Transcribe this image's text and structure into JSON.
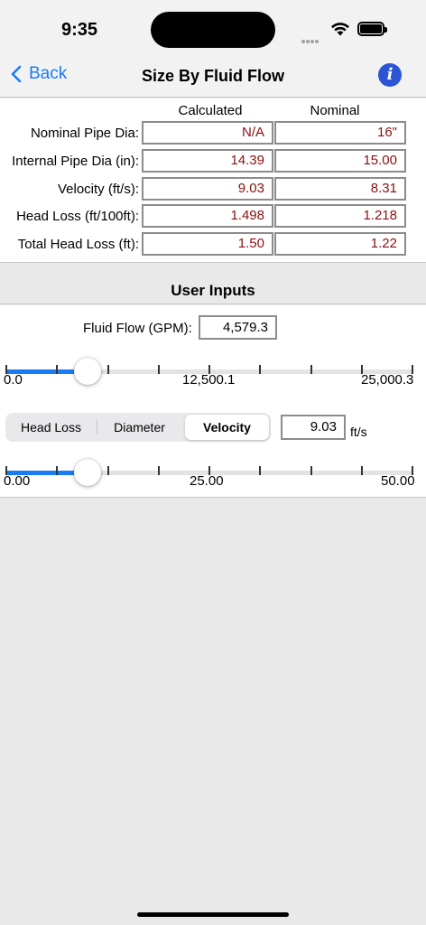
{
  "status": {
    "time": "9:35"
  },
  "nav": {
    "back_label": "Back",
    "title": "Size By Fluid Flow",
    "info_icon": "info-icon"
  },
  "results": {
    "headers": {
      "calculated": "Calculated",
      "nominal": "Nominal"
    },
    "rows": [
      {
        "label": "Nominal Pipe Dia:",
        "calculated": "N/A",
        "nominal": "16\""
      },
      {
        "label": "Internal Pipe Dia (in):",
        "calculated": "14.39",
        "nominal": "15.00"
      },
      {
        "label": "Velocity (ft/s):",
        "calculated": "9.03",
        "nominal": "8.31"
      },
      {
        "label": "Head Loss (ft/100ft):",
        "calculated": "1.498",
        "nominal": "1.218"
      },
      {
        "label": "Total Head Loss (ft):",
        "calculated": "1.50",
        "nominal": "1.22"
      }
    ],
    "value_color": "#8b1010"
  },
  "user_inputs": {
    "title": "User Inputs",
    "fluid_flow": {
      "label": "Fluid Flow (GPM):",
      "value": "4,579.3",
      "slider": {
        "min_label": "0.0",
        "mid_label": "12,500.1",
        "max_label": "25,000.3",
        "fraction": 0.18
      }
    },
    "mode": {
      "options": [
        "Head Loss",
        "Diameter",
        "Velocity"
      ],
      "selected": "Velocity"
    },
    "velocity": {
      "value": "9.03",
      "unit": "ft/s",
      "slider": {
        "min_label": "0.00",
        "mid_label": "25.00",
        "max_label": "50.00",
        "fraction": 0.18
      }
    }
  },
  "colors": {
    "accent": "#1a7cf5",
    "info": "#2b55d5"
  }
}
